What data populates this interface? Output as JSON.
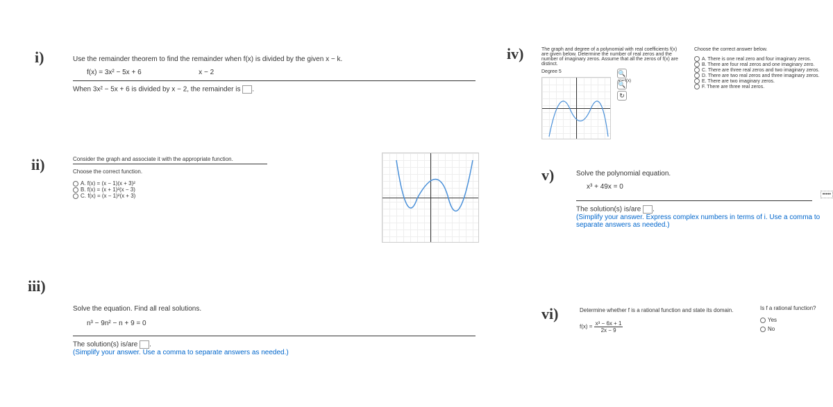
{
  "labels": {
    "i": "i)",
    "ii": "ii)",
    "iii": "iii)",
    "iv": "iv)",
    "v": "v)",
    "vi": "vi)"
  },
  "p1": {
    "instr": "Use the remainder theorem to find the remainder when f(x) is divided by the given x − k.",
    "fx": "f(x) = 3x² − 5x + 6",
    "xk": "x − 2",
    "result_pre": "When 3x² − 5x + 6 is divided by x − 2, the remainder is ",
    "result_post": "."
  },
  "p2": {
    "instr": "Consider the graph and associate it with the appropriate function.",
    "choose": "Choose the correct function.",
    "optA": "A.  f(x) = (x − 1)(x + 3)²",
    "optB": "B.  f(x) = (x + 1)²(x − 3)",
    "optC": "C.  f(x) = (x − 1)²(x + 3)"
  },
  "p3": {
    "instr": "Solve the equation. Find all real solutions.",
    "eq": "n³ − 9n² − n + 9 = 0",
    "sol_pre": "The solution(s) is/are ",
    "sol_post": ".",
    "note": "(Simplify your answer. Use a comma to separate answers as needed.)"
  },
  "p4": {
    "instr": "The graph and degree of a polynomial with real coefficients f(x) are given below. Determine the number of real zeros and the number of imaginary zeros. Assume that all the zeros of f(x) are distinct.",
    "degree": "Degree 5",
    "yfx": "y = f(x)",
    "choose": "Choose the correct answer below.",
    "optA": "A.  There is one real zero and four imaginary zeros.",
    "optB": "B.  There are four real zeros and one imaginary zero.",
    "optC": "C.  There are three real zeros and two imaginary zeros.",
    "optD": "D.  There are two real zeros and three imaginary zeros.",
    "optE": "E.  There are two imaginary zeros.",
    "optF": "F.  There are three real zeros."
  },
  "p5": {
    "instr": "Solve the polynomial equation.",
    "eq": "x³ + 49x = 0",
    "sol_pre": "The solution(s) is/are ",
    "sol_post": ".",
    "note": "(Simplify your answer. Express complex numbers in terms of i. Use a comma to separate answers as needed.)"
  },
  "p6": {
    "instr": "Determine whether f is a rational function and state its domain.",
    "fx_pre": "f(x) = ",
    "num": "x³ − 6x + 1",
    "den": "2x − 9",
    "q": "Is f a rational function?",
    "yes": "Yes",
    "no": "No"
  }
}
